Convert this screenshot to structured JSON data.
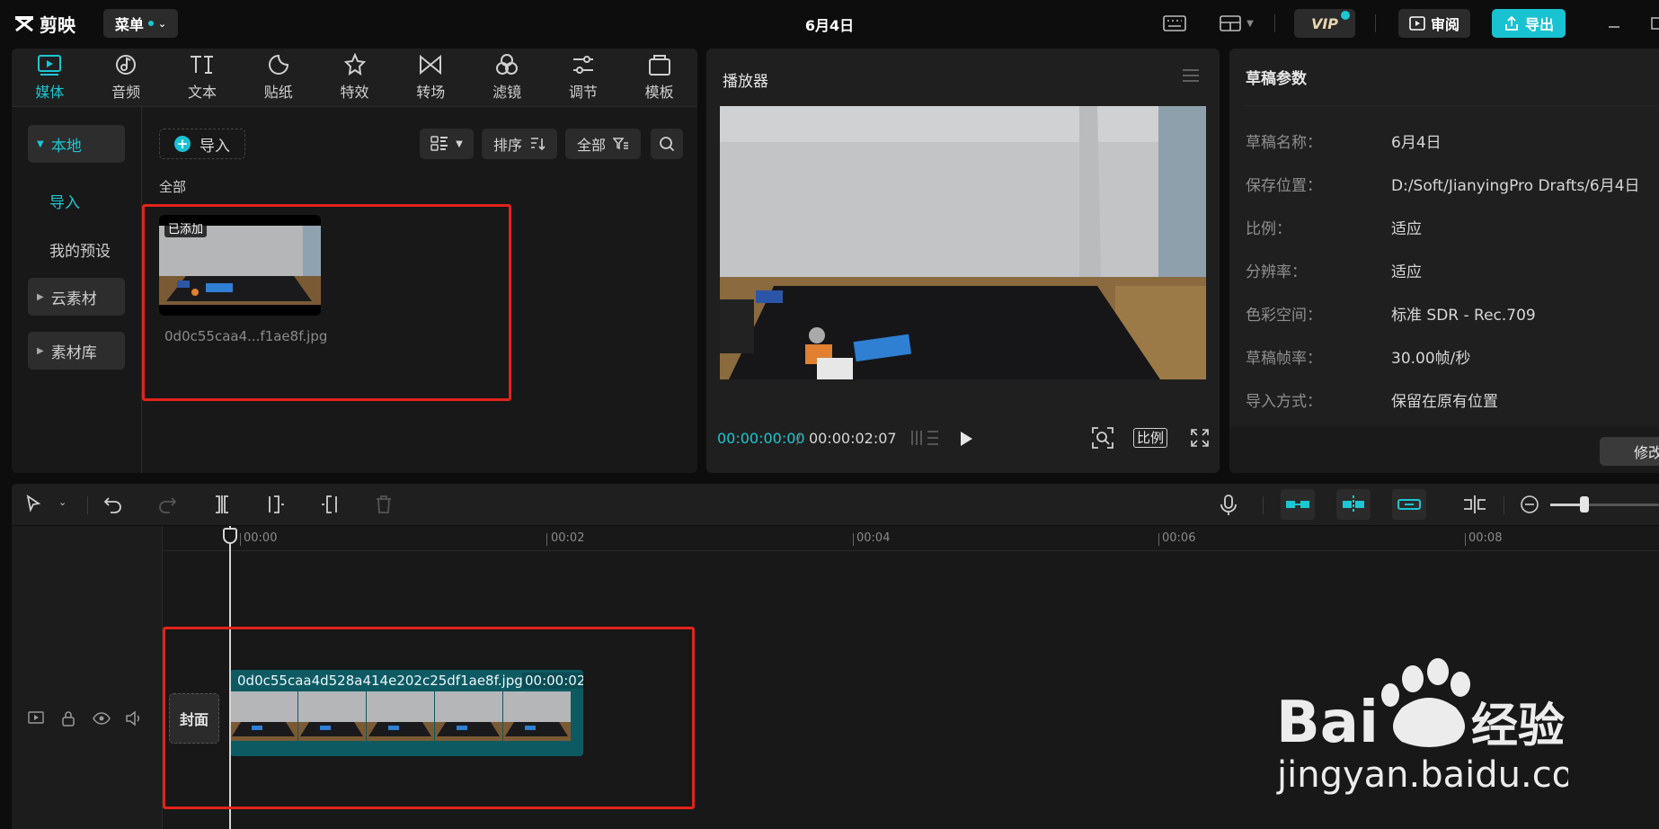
{
  "app": {
    "logo_label": "剪映",
    "menu_label": "菜单",
    "title": "6月4日"
  },
  "topbar": {
    "vip_label": "VIP",
    "review_label": "审阅",
    "export_label": "导出"
  },
  "media_tabs": [
    {
      "label": "媒体",
      "icon": "media-icon",
      "active": true
    },
    {
      "label": "音频",
      "icon": "audio-icon"
    },
    {
      "label": "文本",
      "icon": "text-icon"
    },
    {
      "label": "贴纸",
      "icon": "sticker-icon"
    },
    {
      "label": "特效",
      "icon": "effects-icon"
    },
    {
      "label": "转场",
      "icon": "transition-icon"
    },
    {
      "label": "滤镜",
      "icon": "filter-icon"
    },
    {
      "label": "调节",
      "icon": "adjust-icon"
    },
    {
      "label": "模板",
      "icon": "template-icon"
    }
  ],
  "media_sidebar": {
    "local": "本地",
    "import": "导入",
    "presets": "我的预设",
    "cloud": "云素材",
    "library": "素材库"
  },
  "media_toolbar": {
    "import_label": "导入",
    "sort_label": "排序",
    "filter_label": "全部"
  },
  "media_content": {
    "section_label": "全部",
    "items": [
      {
        "badge": "已添加",
        "filename": "0d0c55caa4...f1ae8f.jpg"
      }
    ]
  },
  "player": {
    "title": "播放器",
    "current_time": "00:00:00:00",
    "total_time": "00:00:02:07",
    "ratio_label": "比例"
  },
  "draft_params": {
    "title": "草稿参数",
    "rows": [
      {
        "key": "草稿名称：",
        "value": "6月4日"
      },
      {
        "key": "保存位置：",
        "value": "D:/Soft/JianyingPro Drafts/6月4日"
      },
      {
        "key": "比例：",
        "value": "适应"
      },
      {
        "key": "分辨率：",
        "value": "适应"
      },
      {
        "key": "色彩空间：",
        "value": "标准 SDR - Rec.709"
      },
      {
        "key": "草稿帧率：",
        "value": "30.00帧/秒"
      },
      {
        "key": "导入方式：",
        "value": "保留在原有位置"
      }
    ],
    "modify_label": "修改"
  },
  "timeline": {
    "ruler": [
      "00:00",
      "00:02",
      "00:04",
      "00:06",
      "00:08"
    ],
    "cover_label": "封面",
    "clip_name": "0d0c55caa4d528a414e202c25df1ae8f.jpg",
    "clip_duration": "00:00:02:"
  },
  "watermark": {
    "brand": "Bai",
    "brand2": "经验",
    "url": "jingyan.baidu.com"
  },
  "colors": {
    "accent": "#1bc7d3",
    "highlight_box": "#e3231c",
    "clip": "#0e5a63"
  }
}
